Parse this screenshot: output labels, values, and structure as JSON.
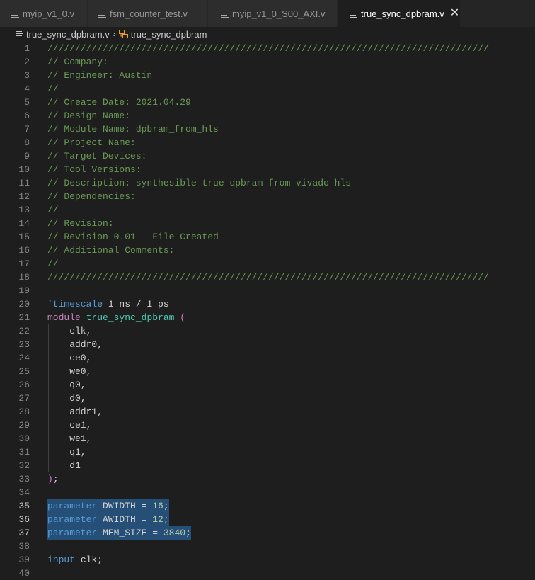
{
  "tabs": [
    {
      "label": "myip_v1_0.v"
    },
    {
      "label": "fsm_counter_test.v"
    },
    {
      "label": "myip_v1_0_S00_AXI.v"
    },
    {
      "label": "true_sync_dpbram.v"
    }
  ],
  "breadcrumb": {
    "file": "true_sync_dpbram.v",
    "symbol": "true_sync_dpbram"
  },
  "editor": {
    "lines": {
      "l1": "////////////////////////////////////////////////////////////////////////////////",
      "l2": "// Company:",
      "l3": "// Engineer: Austin",
      "l4": "//",
      "l5": "// Create Date: 2021.04.29",
      "l6": "// Design Name:",
      "l7": "// Module Name: dpbram_from_hls",
      "l8": "// Project Name:",
      "l9": "// Target Devices:",
      "l10": "// Tool Versions:",
      "l11": "// Description: synthesible true dpbram from vivado hls",
      "l12": "// Dependencies:",
      "l13": "//",
      "l14": "// Revision:",
      "l15": "// Revision 0.01 - File Created",
      "l16": "// Additional Comments:",
      "l17": "//",
      "l18": "////////////////////////////////////////////////////////////////////////////////",
      "l20_kw": "`timescale",
      "l20_rest": " 1 ns / 1 ps",
      "l21_kw": "module",
      "l21_name": "true_sync_dpbram",
      "l21_paren": "(",
      "l22": "    clk,",
      "l23": "    addr0,",
      "l24": "    ce0,",
      "l25": "    we0,",
      "l26": "    q0,",
      "l27": "    d0,",
      "l28": "    addr1,",
      "l29": "    ce1,",
      "l30": "    we1,",
      "l31": "    q1,",
      "l32": "    d1",
      "l33_paren": ")",
      "l33_rest": ";",
      "l35_kw": "parameter",
      "l35_name": " DWIDTH = ",
      "l35_val": "16",
      "l35_end": ";",
      "l36_kw": "parameter",
      "l36_name": " AWIDTH = ",
      "l36_val": "12",
      "l36_end": ";",
      "l37_kw": "parameter",
      "l37_name": " MEM_SIZE = ",
      "l37_val": "3840",
      "l37_end": ";",
      "l39_kw": "input",
      "l39_rest": " clk;"
    },
    "line_numbers": [
      "1",
      "2",
      "3",
      "4",
      "5",
      "6",
      "7",
      "8",
      "9",
      "10",
      "11",
      "12",
      "13",
      "14",
      "15",
      "16",
      "17",
      "18",
      "19",
      "20",
      "21",
      "22",
      "23",
      "24",
      "25",
      "26",
      "27",
      "28",
      "29",
      "30",
      "31",
      "32",
      "33",
      "34",
      "35",
      "36",
      "37",
      "38",
      "39",
      "40"
    ]
  },
  "colors": {
    "background": "#1e1e1e",
    "comment": "#6a9955",
    "keyword": "#569cd6",
    "control_keyword": "#c586c0",
    "type_name": "#4ec9b0",
    "number": "#b5cea8",
    "selection": "#264f78"
  }
}
